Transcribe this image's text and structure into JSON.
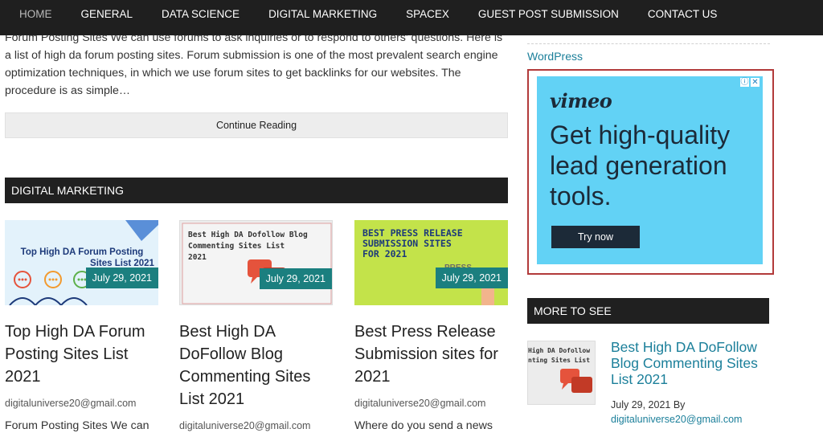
{
  "nav": {
    "items": [
      {
        "label": "HOME",
        "active": true
      },
      {
        "label": "GENERAL"
      },
      {
        "label": "DATA SCIENCE"
      },
      {
        "label": "DIGITAL MARKETING"
      },
      {
        "label": "SPACEX"
      },
      {
        "label": "GUEST POST SUBMISSION"
      },
      {
        "label": "CONTACT US"
      }
    ]
  },
  "main": {
    "excerpt": "Forum Posting Sites We can use forums to ask inquiries or to respond to others' questions. Here is a list of high da forum posting sites. Forum submission is one of the most prevalent search engine optimization techniques, in which we use forum sites to get backlinks for our websites. The procedure is as simple…",
    "continue_label": "Continue Reading",
    "section_title": "DIGITAL MARKETING",
    "cards": [
      {
        "thumb_text": [
          "Top High DA Forum Posting",
          "Sites List 2021"
        ],
        "date": "July 29, 2021",
        "title": "Top High DA Forum Posting Sites List 2021",
        "author": "digitaluniverse20@gmail.com",
        "snippet": "Forum Posting Sites We can"
      },
      {
        "thumb_text": [
          "Best High DA Dofollow Blog",
          "Commenting Sites List",
          "2021"
        ],
        "date": "July 29, 2021",
        "title": "Best High DA DoFollow Blog Commenting Sites List 2021",
        "author": "digitaluniverse20@gmail.com",
        "snippet": ""
      },
      {
        "thumb_text": [
          "BEST PRESS RELEASE",
          "SUBMISSION SITES",
          "FOR 2021",
          "PRESS"
        ],
        "date": "July 29, 2021",
        "title": "Best Press Release Submission sites for 2021",
        "author": "digitaluniverse20@gmail.com",
        "snippet": "Where do you send a news"
      }
    ]
  },
  "sidebar": {
    "wp_link": "WordPress",
    "ad": {
      "logo": "vimeo",
      "headline": "Get high-quality lead generation tools.",
      "cta": "Try now"
    },
    "more_title": "MORE TO SEE",
    "more_item": {
      "thumb_text": [
        "High DA Dofollow",
        "nting Sites List"
      ],
      "title": "Best High DA DoFollow Blog Commenting Sites List 2021",
      "meta": "July 29, 2021 By",
      "author": "digitaluniverse20@gmail.com"
    }
  },
  "colors": {
    "nav_bg": "#1f1f1f",
    "teal": "#1b7f7f",
    "link": "#1b7f9a",
    "ad_bg": "#62d2f5",
    "ad_border": "#b23a3a"
  }
}
